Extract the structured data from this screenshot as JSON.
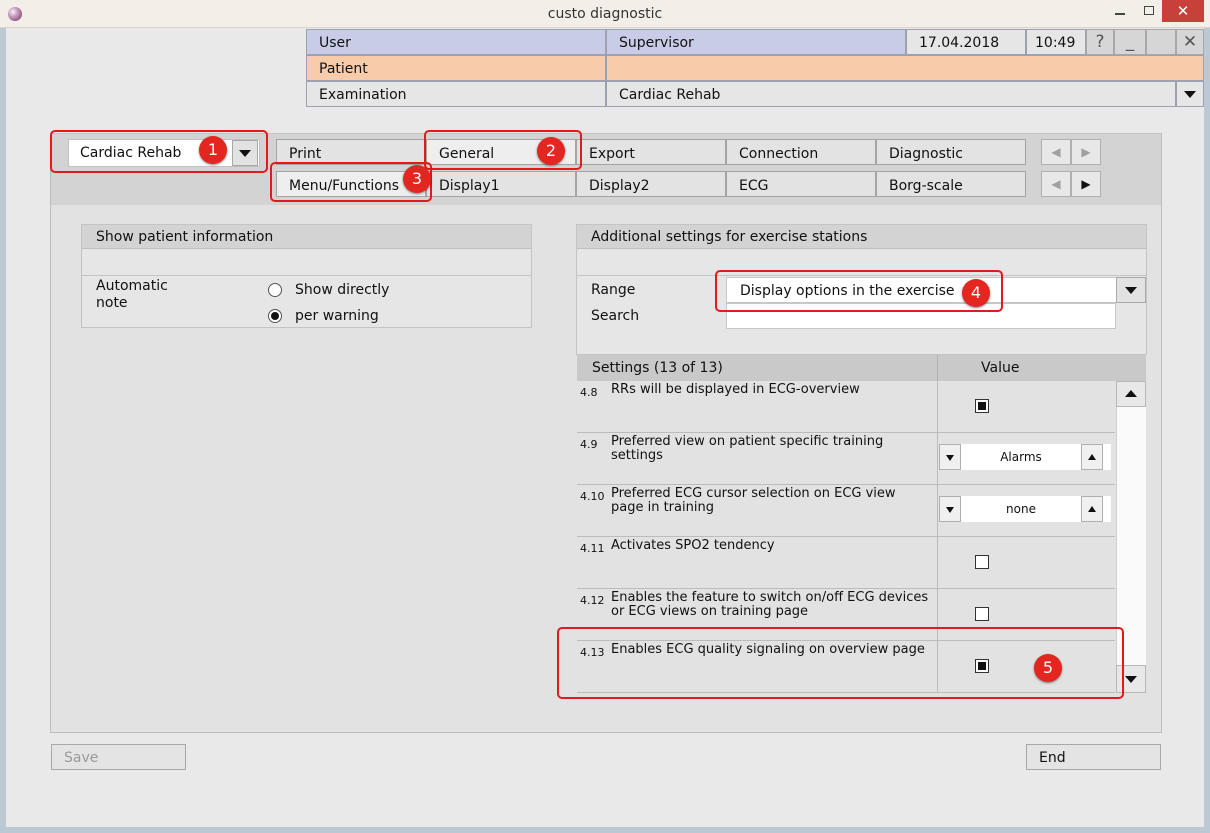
{
  "window": {
    "title": "custo diagnostic"
  },
  "header": {
    "user_label": "User",
    "user_value": "Supervisor",
    "date": "17.04.2018",
    "time": "10:49",
    "help": "?",
    "minimize": "_",
    "close": "✕",
    "patient_label": "Patient",
    "patient_value": "",
    "examination_label": "Examination",
    "examination_value": "Cardiac Rehab"
  },
  "mode_combo": {
    "value": "Cardiac Rehab"
  },
  "tabs_row1": [
    "Print",
    "General",
    "Export",
    "Connection",
    "Diagnostic"
  ],
  "tabs_row2": [
    "Menu/Functions",
    "Display1",
    "Display2",
    "ECG",
    "Borg-scale"
  ],
  "tab_arrows": {
    "left": "◀",
    "right": "▶"
  },
  "patient_info": {
    "title": "Show patient information",
    "auto_note_label": "Automatic\nnote",
    "options": [
      "Show directly",
      "per warning"
    ],
    "selected": 1
  },
  "additional": {
    "title": "Additional settings for exercise stations",
    "range_label": "Range",
    "range_value": "Display options in the exercise",
    "search_label": "Search",
    "search_value": "",
    "settings_header": "Settings (13 of 13)",
    "value_header": "Value",
    "rows": [
      {
        "num": "4.8",
        "text": "RRs will be displayed in ECG-overview",
        "type": "checkbox",
        "checked": true
      },
      {
        "num": "4.9",
        "text": "Preferred view on patient specific training settings",
        "type": "spin",
        "value": "Alarms"
      },
      {
        "num": "4.10",
        "text": "Preferred ECG cursor selection on ECG view page in training",
        "type": "spin",
        "value": "none"
      },
      {
        "num": "4.11",
        "text": "Activates SPO2 tendency",
        "type": "checkbox",
        "checked": false
      },
      {
        "num": "4.12",
        "text": "Enables the feature to switch on/off ECG devices or ECG views on training page",
        "type": "checkbox",
        "checked": false
      },
      {
        "num": "4.13",
        "text": "Enables ECG quality signaling on overview page",
        "type": "checkbox",
        "checked": true
      }
    ]
  },
  "buttons": {
    "save": "Save",
    "end": "End"
  },
  "callouts": [
    "1",
    "2",
    "3",
    "4",
    "5"
  ],
  "colors": {
    "user_row": "#c8cce6",
    "patient_row": "#f8ccaa",
    "callout": "#e3261f",
    "close_button": "#c8403a"
  }
}
